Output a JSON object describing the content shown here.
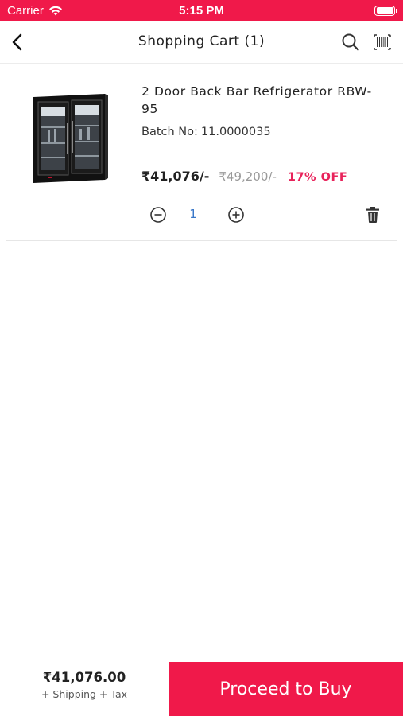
{
  "status_bar": {
    "carrier": "Carrier",
    "time": "5:15 PM",
    "icons": [
      "wifi-icon",
      "battery-icon"
    ]
  },
  "header": {
    "title": "Shopping Cart (1)",
    "icons": [
      "back-arrow-icon",
      "search-icon",
      "barcode-scan-icon"
    ]
  },
  "cart": {
    "items": [
      {
        "name": "2 Door Back Bar Refrigerator RBW-95",
        "batch_label": "Batch No:",
        "batch_value": "11.0000035",
        "price": "₹41,076/-",
        "mrp": "₹49,200/-",
        "discount": "17% OFF",
        "quantity": "1",
        "icons": [
          "minus-circle-icon",
          "plus-circle-icon",
          "trash-icon"
        ]
      }
    ]
  },
  "footer": {
    "total": "₹41,076.00",
    "note": "+ Shipping + Tax",
    "buy_label": "Proceed to Buy"
  },
  "colors": {
    "accent": "#f0194a",
    "discount": "#e8225a",
    "quantity": "#3a78c9"
  }
}
